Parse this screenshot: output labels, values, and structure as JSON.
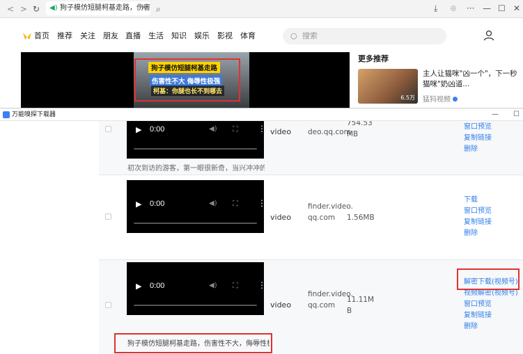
{
  "browser": {
    "tab_title": "狗子模仿短腿柯基走路，伤害性",
    "back": "<",
    "forward": ">",
    "refresh": "↻",
    "close_tab": "✕",
    "search_tab": "⌕",
    "download": "⤓",
    "globe": "⊕",
    "menu": "···",
    "minimize": "—",
    "maximize": "☐",
    "close": "✕"
  },
  "site": {
    "nav": [
      "首页",
      "推荐",
      "关注",
      "朋友",
      "直播",
      "生活",
      "知识",
      "娱乐",
      "影视",
      "体育"
    ],
    "search_placeholder": "搜索",
    "overlay": {
      "line1": "狗子模仿短腿柯基走路",
      "line2": "伤害性不大 侮辱性极强",
      "line3": "柯基：你腿也长不到哪去"
    },
    "more": {
      "title": "更多推荐",
      "item_title": "主人让猫咪\"凶一个\"，下一秒猫咪\"奶凶道...",
      "views": "6.5万",
      "source": "猛犸视频"
    }
  },
  "downloader": {
    "window_title": "万能嗅探下载器",
    "minimize": "—",
    "maximize": "☐",
    "rows": [
      {
        "time": "0:00",
        "type": "video",
        "source": "deo.qq.com",
        "size": "754.53 MB",
        "actions": [
          "窗口预览",
          "复制链接",
          "删除"
        ],
        "desc": "初次到访的游客，第一眼很新奇，当兴冲冲的到"
      },
      {
        "time": "0:00",
        "type": "video",
        "source": "finder.video.qq.com",
        "size": "1.56MB",
        "actions": [
          "下载",
          "窗口预览",
          "复制链接",
          "删除"
        ]
      },
      {
        "time": "0:00",
        "type": "video",
        "source": "finder.video.qq.com",
        "size": "11.11MB",
        "actions": [
          "解密下载(视频号)",
          "视频解密(视频号)",
          "窗口预览",
          "复制链接",
          "删除"
        ],
        "desc": "狗子模仿短腿柯基走路，伤害性不大，侮辱性极"
      }
    ]
  }
}
